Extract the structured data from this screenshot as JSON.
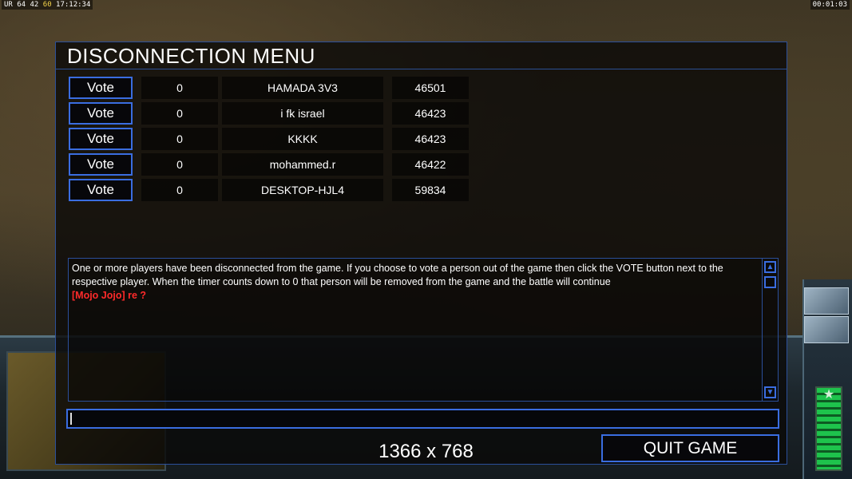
{
  "overlay": {
    "stats_prefix": "UR 64 42",
    "stats_fps": "60",
    "clock": "17:12:34",
    "timer": "00:01:03"
  },
  "dialog": {
    "title": "DISCONNECTION MENU",
    "players": [
      {
        "vote_label": "Vote",
        "count": "0",
        "name": "HAMADA 3V3",
        "ping": "46501"
      },
      {
        "vote_label": "Vote",
        "count": "0",
        "name": "i fk israel",
        "ping": "46423"
      },
      {
        "vote_label": "Vote",
        "count": "0",
        "name": "KKKK",
        "ping": "46423"
      },
      {
        "vote_label": "Vote",
        "count": "0",
        "name": "mohammed.r",
        "ping": "46422"
      },
      {
        "vote_label": "Vote",
        "count": "0",
        "name": "DESKTOP-HJL4",
        "ping": "59834"
      }
    ],
    "message": "One or more players have been disconnected from the game. If you choose to vote a person out of the game then click the VOTE button next to the respective player. When the timer counts down to 0 that person will be removed from the game and the battle will continue",
    "chat_line": "[Mojo Jojo] re ?",
    "chat_input_value": "",
    "resolution": "1366 x 768",
    "quit_label": "QUIT GAME"
  },
  "icons": {
    "scroll_up": "arrow-up-icon",
    "scroll_down": "arrow-down-icon",
    "rank": "star-icon"
  },
  "colors": {
    "accent_border": "#3a6de0",
    "chat_red": "#ff2a2a",
    "dialog_bg": "#0a0907"
  }
}
